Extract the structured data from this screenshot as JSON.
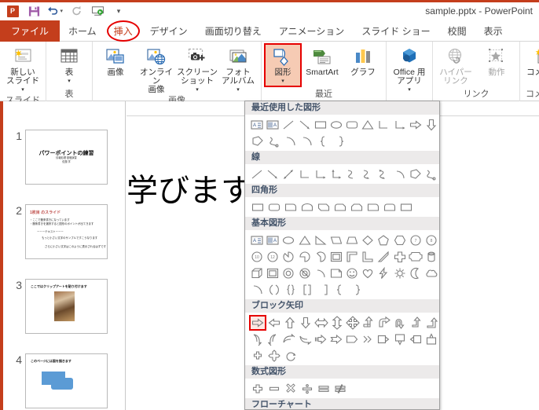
{
  "titlebar": {
    "doc_title": "sample.pptx - PowerPoint",
    "logo_text": "P",
    "qat": [
      {
        "name": "powerpoint-logo-icon",
        "label": "P"
      },
      {
        "name": "save-icon",
        "label": "Save"
      },
      {
        "name": "undo-icon",
        "label": "Undo"
      },
      {
        "name": "redo-icon",
        "label": "Redo"
      },
      {
        "name": "start-slideshow-icon",
        "label": "Start From Beginning"
      },
      {
        "name": "customize-qat-icon",
        "label": "Customize Quick Access Toolbar"
      }
    ]
  },
  "tabs": [
    {
      "label": "ファイル",
      "state": "file"
    },
    {
      "label": "ホーム",
      "state": "normal"
    },
    {
      "label": "挿入",
      "state": "circled"
    },
    {
      "label": "デザイン",
      "state": "normal"
    },
    {
      "label": "画面切り替え",
      "state": "normal"
    },
    {
      "label": "アニメーション",
      "state": "normal"
    },
    {
      "label": "スライド ショー",
      "state": "normal"
    },
    {
      "label": "校閲",
      "state": "normal"
    },
    {
      "label": "表示",
      "state": "normal"
    }
  ],
  "ribbon": {
    "groups": [
      {
        "label": "スライド",
        "buttons": [
          {
            "name": "new-slide-button",
            "icon": "new-slide-icon",
            "line1": "新しい",
            "line2": "スライド",
            "arrow": "▾",
            "dim": false,
            "selected": false
          }
        ]
      },
      {
        "label": "表",
        "buttons": [
          {
            "name": "table-button",
            "icon": "table-icon",
            "line1": "表",
            "line2": "",
            "arrow": "▾",
            "dim": false,
            "selected": false
          }
        ]
      },
      {
        "label": "画像",
        "buttons": [
          {
            "name": "pictures-button",
            "icon": "picture-icon",
            "line1": "画像",
            "line2": "",
            "arrow": "",
            "dim": false,
            "selected": false
          },
          {
            "name": "online-pictures-button",
            "icon": "online-picture-icon",
            "line1": "オンライン",
            "line2": "画像",
            "arrow": "",
            "dim": false,
            "selected": false
          },
          {
            "name": "screenshot-button",
            "icon": "screenshot-icon",
            "line1": "スクリーン",
            "line2": "ショット",
            "arrow": "▾",
            "dim": false,
            "selected": false
          },
          {
            "name": "photo-album-button",
            "icon": "photo-album-icon",
            "line1": "フォト",
            "line2": "アルバム",
            "arrow": "▾",
            "dim": false,
            "selected": false
          }
        ]
      },
      {
        "label": "最近",
        "buttons": [
          {
            "name": "shapes-button",
            "icon": "shapes-icon",
            "line1": "図形",
            "line2": "",
            "arrow": "▾",
            "dim": false,
            "selected": true
          },
          {
            "name": "smartart-button",
            "icon": "smartart-icon",
            "line1": "SmartArt",
            "line2": "",
            "arrow": "",
            "dim": false,
            "selected": false
          },
          {
            "name": "chart-button",
            "icon": "chart-icon",
            "line1": "グラフ",
            "line2": "",
            "arrow": "",
            "dim": false,
            "selected": false
          }
        ]
      },
      {
        "label": "",
        "buttons": [
          {
            "name": "office-apps-button",
            "icon": "office-apps-icon",
            "line1": "Office 用",
            "line2": "アプリ",
            "arrow": "▾",
            "dim": false,
            "selected": false
          }
        ]
      },
      {
        "label": "リンク",
        "buttons": [
          {
            "name": "hyperlink-button",
            "icon": "hyperlink-icon",
            "line1": "ハイパーリンク",
            "line2": "",
            "arrow": "",
            "dim": true,
            "selected": false
          },
          {
            "name": "action-button",
            "icon": "action-icon",
            "line1": "動作",
            "line2": "",
            "arrow": "",
            "dim": true,
            "selected": false
          }
        ]
      },
      {
        "label": "コメント",
        "buttons": [
          {
            "name": "comment-button",
            "icon": "comment-icon",
            "line1": "コメント",
            "line2": "",
            "arrow": "",
            "dim": false,
            "selected": false
          }
        ]
      },
      {
        "label": "",
        "buttons": [
          {
            "name": "text-box-button",
            "icon": "text-box-icon",
            "line1": "",
            "line2": "",
            "arrow": "",
            "dim": false,
            "selected": false
          }
        ]
      }
    ]
  },
  "slides_panel": {
    "slides": [
      {
        "number": "1",
        "title": "パワーポイントの練習",
        "subtitle_line1": "情報処理 基礎演習",
        "subtitle_line2": "佐藤 学"
      },
      {
        "number": "2",
        "title": "1枚目 のスライド",
        "lines": [
          "・ここで箇条書きになっています",
          "・箇条書きを選択すると図形のポイントが出てきます",
          "ーーーテキストーーー",
          "もっと小さい文字のサンプルですこうなります",
          "さらに小さい文字はこのように表示されるはずです"
        ]
      },
      {
        "number": "3",
        "title": "ここではクリップアートを貼り付けます"
      },
      {
        "number": "4",
        "title": "このページには図を描きます"
      }
    ]
  },
  "main_slide": {
    "visible_text": "学びます"
  },
  "shapes_menu": {
    "sections": [
      {
        "name": "recent-shapes-section",
        "heading": "最近使用した図形",
        "rows": [
          [
            "textbox",
            "vtextbox",
            "line",
            "line-arrow",
            "rect",
            "oval",
            "round-rect",
            "triangle",
            "elbow",
            "elbow-arrow",
            "right-arrow",
            "down-arrow"
          ],
          [
            "freeform",
            "scribble",
            "curve-arc",
            "arc2",
            "brace-left",
            "brace-right"
          ]
        ],
        "marked": null
      },
      {
        "name": "lines-section",
        "heading": "線",
        "rows": [
          [
            "line",
            "line-arrow",
            "line-double-arrow",
            "elbow",
            "elbow-arrow",
            "elbow-double-arrow",
            "curve",
            "curve-arrow",
            "curve-double-arrow",
            "arc",
            "freeform",
            "scribble"
          ]
        ],
        "marked": null
      },
      {
        "name": "rectangles-section",
        "heading": "四角形",
        "rows": [
          [
            "rect",
            "round-rect",
            "snip-single",
            "round-top",
            "snip-diag",
            "snip-round",
            "snip-same",
            "round-single",
            "round-same",
            "rect-plain"
          ]
        ],
        "marked": null
      },
      {
        "name": "basic-shapes-section",
        "heading": "基本図形",
        "rows": [
          [
            "textbox",
            "vtextbox",
            "oval",
            "triangle",
            "right-triangle",
            "parallelogram",
            "trapezoid",
            "diamond",
            "pentagon",
            "hexagon",
            "heptagon",
            "octagon"
          ],
          [
            "decagon",
            "dodecagon",
            "pie",
            "teardrop",
            "chord",
            "frame",
            "corner",
            "l-shape",
            "diagonal-stripe",
            "cross",
            "plaque",
            "cylinder"
          ],
          [
            "cube",
            "bevel",
            "donut",
            "no-symbol",
            "arc",
            "folded-corner",
            "smiley",
            "heart",
            "lightning",
            "sun",
            "moon",
            "cloud"
          ],
          [
            "arc2",
            "bracket-round",
            "brace-curly",
            "bracket-square",
            "bracket-square-r",
            "brace-left",
            "brace-right"
          ]
        ],
        "marked": null
      },
      {
        "name": "block-arrows-section",
        "heading": "ブロック矢印",
        "rows": [
          [
            "right-arrow",
            "left-arrow",
            "up-arrow",
            "down-arrow",
            "left-right-arrow",
            "up-down-arrow",
            "quad-arrow",
            "bent-up-arrow",
            "bent-arrow",
            "u-turn",
            "left-up-arrow",
            "bent-arrow2"
          ],
          [
            "curved-right",
            "curved-left",
            "curved-up",
            "curved-down",
            "striped-right",
            "notched-right",
            "pentagon-arrow",
            "chevron",
            "right-callout",
            "down-callout",
            "left-callout",
            "up-callout"
          ],
          [
            "cross-arrow",
            "quad-callout",
            "circular-arrow"
          ]
        ],
        "marked": {
          "row": 0,
          "col": 0
        }
      },
      {
        "name": "equation-shapes-section",
        "heading": "数式図形",
        "rows": [
          [
            "plus",
            "minus",
            "multiply",
            "divide",
            "equal",
            "not-equal"
          ]
        ],
        "marked": null
      },
      {
        "name": "flowchart-section",
        "heading": "フローチャート",
        "rows": [],
        "marked": null
      }
    ]
  }
}
